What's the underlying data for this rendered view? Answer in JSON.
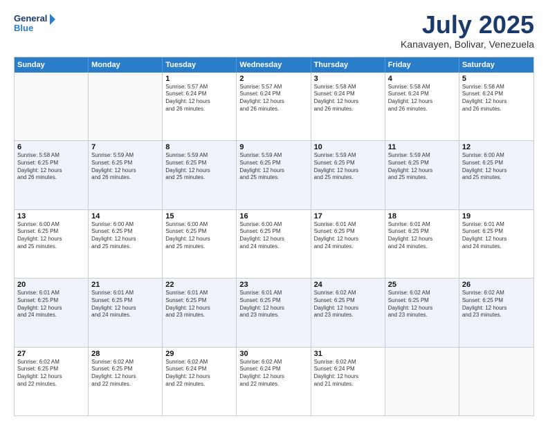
{
  "logo": {
    "line1": "General",
    "line2": "Blue"
  },
  "title": "July 2025",
  "subtitle": "Kanavayen, Bolivar, Venezuela",
  "header_days": [
    "Sunday",
    "Monday",
    "Tuesday",
    "Wednesday",
    "Thursday",
    "Friday",
    "Saturday"
  ],
  "weeks": [
    [
      {
        "day": "",
        "info": ""
      },
      {
        "day": "",
        "info": ""
      },
      {
        "day": "1",
        "info": "Sunrise: 5:57 AM\nSunset: 6:24 PM\nDaylight: 12 hours\nand 26 minutes."
      },
      {
        "day": "2",
        "info": "Sunrise: 5:57 AM\nSunset: 6:24 PM\nDaylight: 12 hours\nand 26 minutes."
      },
      {
        "day": "3",
        "info": "Sunrise: 5:58 AM\nSunset: 6:24 PM\nDaylight: 12 hours\nand 26 minutes."
      },
      {
        "day": "4",
        "info": "Sunrise: 5:58 AM\nSunset: 6:24 PM\nDaylight: 12 hours\nand 26 minutes."
      },
      {
        "day": "5",
        "info": "Sunrise: 5:58 AM\nSunset: 6:24 PM\nDaylight: 12 hours\nand 26 minutes."
      }
    ],
    [
      {
        "day": "6",
        "info": "Sunrise: 5:58 AM\nSunset: 6:25 PM\nDaylight: 12 hours\nand 26 minutes."
      },
      {
        "day": "7",
        "info": "Sunrise: 5:59 AM\nSunset: 6:25 PM\nDaylight: 12 hours\nand 26 minutes."
      },
      {
        "day": "8",
        "info": "Sunrise: 5:59 AM\nSunset: 6:25 PM\nDaylight: 12 hours\nand 25 minutes."
      },
      {
        "day": "9",
        "info": "Sunrise: 5:59 AM\nSunset: 6:25 PM\nDaylight: 12 hours\nand 25 minutes."
      },
      {
        "day": "10",
        "info": "Sunrise: 5:59 AM\nSunset: 6:25 PM\nDaylight: 12 hours\nand 25 minutes."
      },
      {
        "day": "11",
        "info": "Sunrise: 5:59 AM\nSunset: 6:25 PM\nDaylight: 12 hours\nand 25 minutes."
      },
      {
        "day": "12",
        "info": "Sunrise: 6:00 AM\nSunset: 6:25 PM\nDaylight: 12 hours\nand 25 minutes."
      }
    ],
    [
      {
        "day": "13",
        "info": "Sunrise: 6:00 AM\nSunset: 6:25 PM\nDaylight: 12 hours\nand 25 minutes."
      },
      {
        "day": "14",
        "info": "Sunrise: 6:00 AM\nSunset: 6:25 PM\nDaylight: 12 hours\nand 25 minutes."
      },
      {
        "day": "15",
        "info": "Sunrise: 6:00 AM\nSunset: 6:25 PM\nDaylight: 12 hours\nand 25 minutes."
      },
      {
        "day": "16",
        "info": "Sunrise: 6:00 AM\nSunset: 6:25 PM\nDaylight: 12 hours\nand 24 minutes."
      },
      {
        "day": "17",
        "info": "Sunrise: 6:01 AM\nSunset: 6:25 PM\nDaylight: 12 hours\nand 24 minutes."
      },
      {
        "day": "18",
        "info": "Sunrise: 6:01 AM\nSunset: 6:25 PM\nDaylight: 12 hours\nand 24 minutes."
      },
      {
        "day": "19",
        "info": "Sunrise: 6:01 AM\nSunset: 6:25 PM\nDaylight: 12 hours\nand 24 minutes."
      }
    ],
    [
      {
        "day": "20",
        "info": "Sunrise: 6:01 AM\nSunset: 6:25 PM\nDaylight: 12 hours\nand 24 minutes."
      },
      {
        "day": "21",
        "info": "Sunrise: 6:01 AM\nSunset: 6:25 PM\nDaylight: 12 hours\nand 24 minutes."
      },
      {
        "day": "22",
        "info": "Sunrise: 6:01 AM\nSunset: 6:25 PM\nDaylight: 12 hours\nand 23 minutes."
      },
      {
        "day": "23",
        "info": "Sunrise: 6:01 AM\nSunset: 6:25 PM\nDaylight: 12 hours\nand 23 minutes."
      },
      {
        "day": "24",
        "info": "Sunrise: 6:02 AM\nSunset: 6:25 PM\nDaylight: 12 hours\nand 23 minutes."
      },
      {
        "day": "25",
        "info": "Sunrise: 6:02 AM\nSunset: 6:25 PM\nDaylight: 12 hours\nand 23 minutes."
      },
      {
        "day": "26",
        "info": "Sunrise: 6:02 AM\nSunset: 6:25 PM\nDaylight: 12 hours\nand 23 minutes."
      }
    ],
    [
      {
        "day": "27",
        "info": "Sunrise: 6:02 AM\nSunset: 6:25 PM\nDaylight: 12 hours\nand 22 minutes."
      },
      {
        "day": "28",
        "info": "Sunrise: 6:02 AM\nSunset: 6:25 PM\nDaylight: 12 hours\nand 22 minutes."
      },
      {
        "day": "29",
        "info": "Sunrise: 6:02 AM\nSunset: 6:24 PM\nDaylight: 12 hours\nand 22 minutes."
      },
      {
        "day": "30",
        "info": "Sunrise: 6:02 AM\nSunset: 6:24 PM\nDaylight: 12 hours\nand 22 minutes."
      },
      {
        "day": "31",
        "info": "Sunrise: 6:02 AM\nSunset: 6:24 PM\nDaylight: 12 hours\nand 21 minutes."
      },
      {
        "day": "",
        "info": ""
      },
      {
        "day": "",
        "info": ""
      }
    ]
  ]
}
